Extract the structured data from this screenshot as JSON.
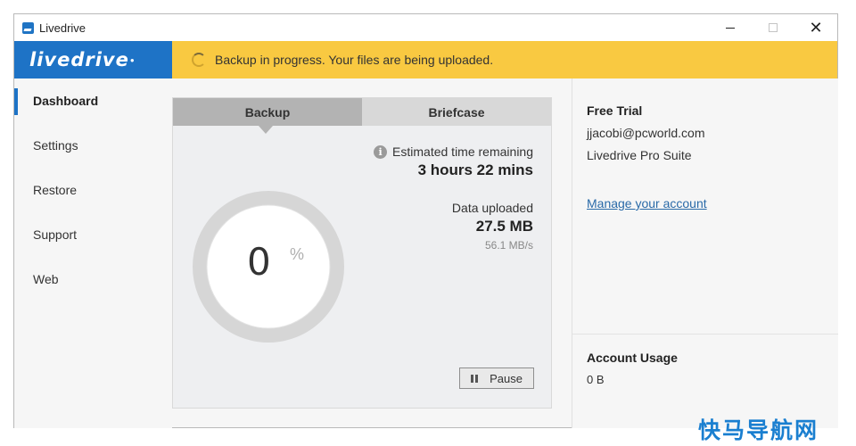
{
  "window": {
    "title": "Livedrive",
    "controls": {
      "minimize": "minimize",
      "maximize": "maximize",
      "close": "✕"
    }
  },
  "header": {
    "logo_text": "livedrive",
    "banner_text": "Backup in progress. Your files are being uploaded."
  },
  "sidebar": {
    "items": [
      {
        "label": "Dashboard",
        "active": true
      },
      {
        "label": "Settings"
      },
      {
        "label": "Restore"
      },
      {
        "label": "Support"
      },
      {
        "label": "Web"
      }
    ]
  },
  "main": {
    "tabs": [
      {
        "label": "Backup",
        "active": true
      },
      {
        "label": "Briefcase"
      }
    ],
    "progress_percent": "0",
    "percent_symbol": "%",
    "time_label": "Estimated time remaining",
    "time_value": "3 hours 22 mins",
    "upload_label": "Data uploaded",
    "upload_value": "27.5 MB",
    "upload_rate": "56.1 MB/s",
    "pause_label": "Pause"
  },
  "account": {
    "plan": "Free Trial",
    "email": "jjacobi@pcworld.com",
    "product": "Livedrive Pro Suite",
    "manage_link": "Manage your account",
    "usage_title": "Account Usage",
    "usage_value": "0 B"
  },
  "watermark": "快马导航网",
  "colors": {
    "brand_blue": "#1e73c6",
    "banner_yellow": "#f9c941",
    "link": "#2a6aa8"
  }
}
